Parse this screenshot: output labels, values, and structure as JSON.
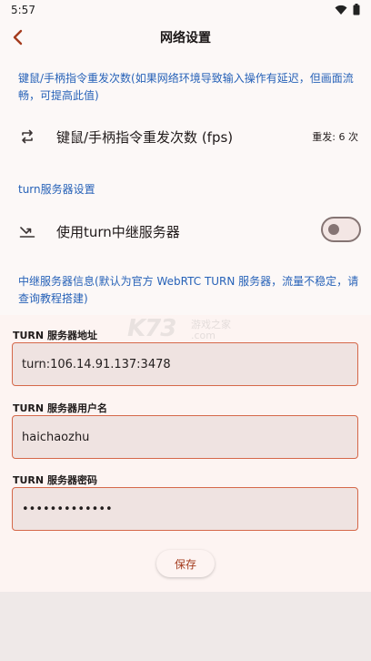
{
  "status_bar": {
    "time": "5:57",
    "icons": [
      "wifi-icon",
      "battery-icon"
    ]
  },
  "header": {
    "title": "网络设置",
    "back_icon": "back-arrow-icon"
  },
  "resend_section": {
    "description": "键鼠/手柄指令重发次数(如果网络环境导致输入操作有延迟，但画面流畅，可提高此值)",
    "row": {
      "icon": "repeat-icon",
      "title": "键鼠/手柄指令重发次数 (fps)",
      "value": "重发: 6 次"
    }
  },
  "turn_section": {
    "header": "turn服务器设置",
    "row": {
      "icon": "relay-icon",
      "title": "使用turn中继服务器",
      "enabled": false
    },
    "info": "中继服务器信息(默认为官方 WebRTC TURN 服务器，流量不稳定，请查询教程搭建)"
  },
  "form": {
    "address": {
      "label": "TURN 服务器地址",
      "value": "turn:106.14.91.137:3478"
    },
    "username": {
      "label": "TURN 服务器用户名",
      "value": "haichaozhu"
    },
    "password": {
      "label": "TURN 服务器密码",
      "value": "•••••••••••••"
    },
    "save_label": "保存"
  },
  "watermark": {
    "logo": "K73",
    "text": "游戏之家",
    "domain": ".com"
  },
  "colors": {
    "accent": "#a43c1e",
    "link_blue": "#2762b8",
    "field_border": "#d5684a"
  }
}
